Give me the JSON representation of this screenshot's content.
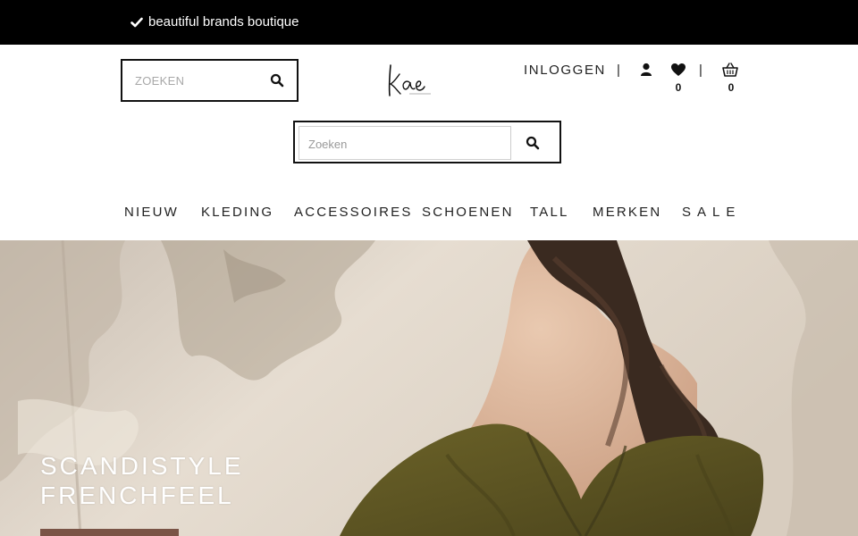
{
  "topbar": {
    "usp_text": "beautiful brands boutique",
    "check_icon": "check-icon"
  },
  "header": {
    "search_small": {
      "placeholder": "ZOEKEN",
      "icon": "search-icon"
    },
    "logo": {
      "icon": "kae-logo"
    },
    "account": {
      "login_label": "INLOGGEN",
      "separator": "|",
      "user_icon": "user-icon",
      "wishlist_icon": "heart-icon",
      "wishlist_count": "0",
      "cart_icon": "basket-icon",
      "cart_count": "0"
    },
    "search_large": {
      "placeholder": "Zoeken",
      "icon": "search-icon"
    }
  },
  "nav": {
    "items": [
      {
        "label": "NIEUW"
      },
      {
        "label": "KLEDING"
      },
      {
        "label": "ACCESSOIRES"
      },
      {
        "label": "SCHOENEN"
      },
      {
        "label": "TALL"
      },
      {
        "label": "MERKEN"
      },
      {
        "label": "SALE"
      }
    ]
  },
  "hero": {
    "headline_line1": "SCANDISTYLE",
    "headline_line2": "FRENCHFEEL",
    "cta_color": "#7a5446"
  },
  "colors": {
    "topbar_bg": "#000000",
    "text": "#222222",
    "accent": "#7a5446"
  }
}
